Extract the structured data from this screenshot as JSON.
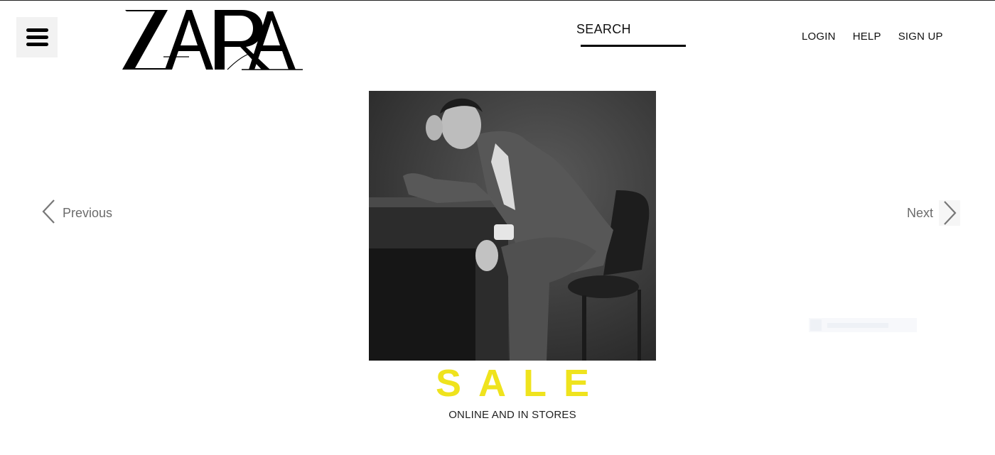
{
  "header": {
    "brand": "ZARA",
    "menu_icon": "hamburger-menu-icon",
    "search_label": "SEARCH",
    "links": [
      "LOGIN",
      "HELP",
      "SIGN UP"
    ]
  },
  "carousel": {
    "previous_label": "Previous",
    "next_label": "Next",
    "previous_icon": "chevron-left-icon",
    "next_icon": "chevron-right-icon",
    "image_description_icon": "model-photo"
  },
  "promo": {
    "title": "SALE",
    "subtitle": "ONLINE AND IN STORES",
    "title_color": "#efe31d"
  },
  "colors": {
    "text": "#111111",
    "nav_text": "#6b6b6b",
    "menu_bg": "#f2f2f2"
  }
}
